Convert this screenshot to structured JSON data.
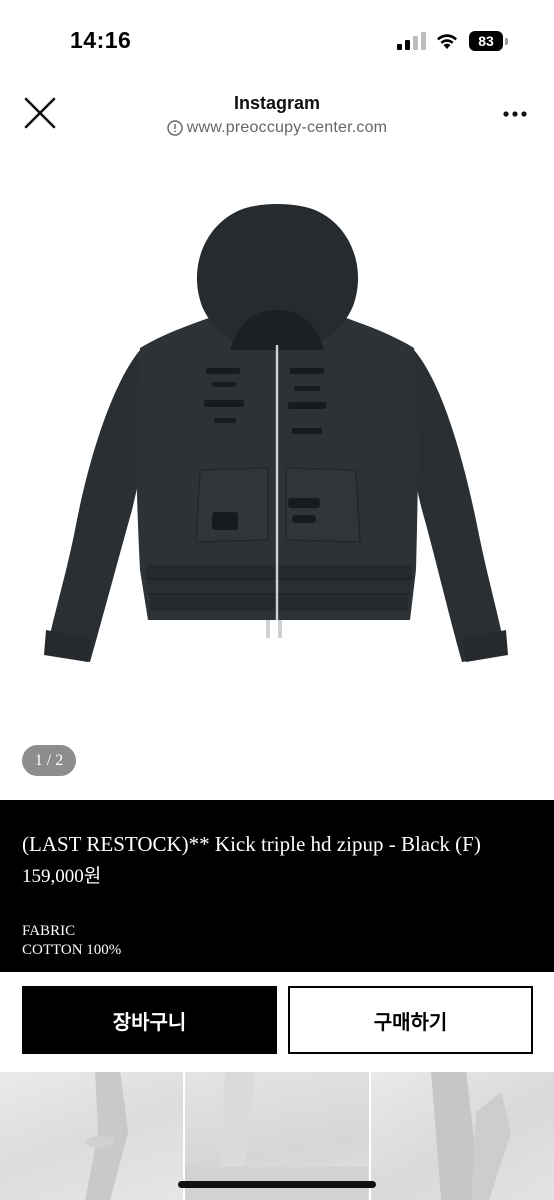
{
  "status_bar": {
    "time": "14:16",
    "battery_level": "83",
    "icons": [
      "signal-icon",
      "wifi-icon",
      "battery-icon"
    ]
  },
  "browser_header": {
    "title": "Instagram",
    "url": "www.preoccupy-center.com",
    "icons": [
      "close-icon",
      "info-icon",
      "more-icon"
    ]
  },
  "product": {
    "image_pager": "1 / 2",
    "name": "(LAST RESTOCK)** Kick triple hd zipup - Black (F)",
    "price": "159,000원",
    "fabric_label": "FABRIC",
    "fabric_value": "COTTON 100%"
  },
  "actions": {
    "cart_label": "장바구니",
    "buy_label": "구매하기"
  },
  "colors": {
    "info_background": "#000000",
    "cart_button": "#000000",
    "buy_button_border": "#000000",
    "pager_background": "#8d8d8d"
  }
}
